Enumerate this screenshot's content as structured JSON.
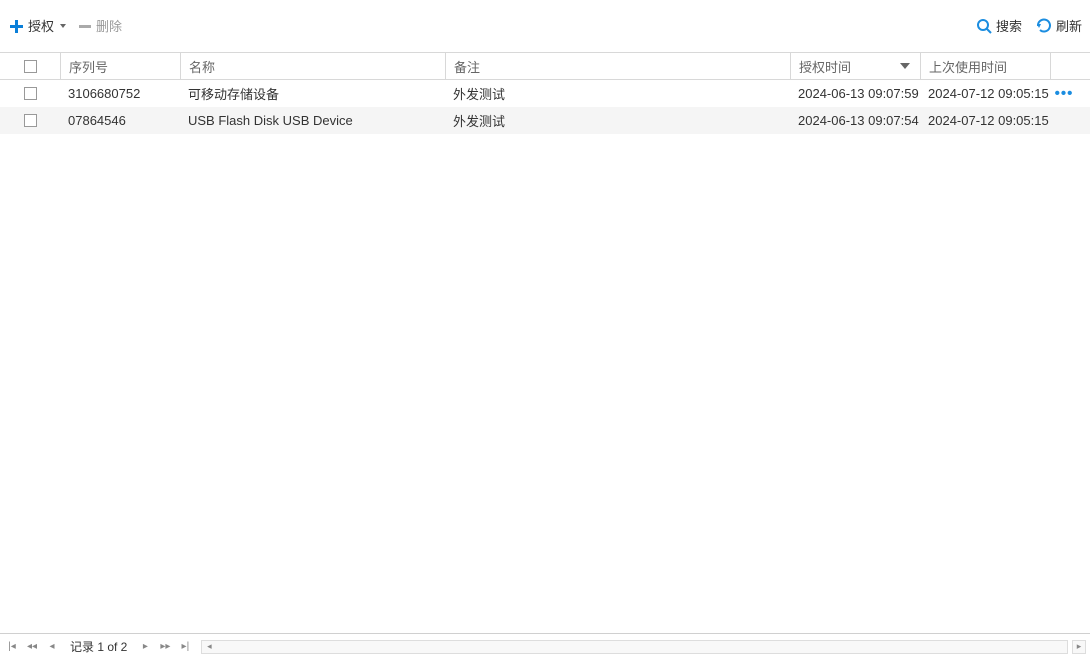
{
  "toolbar": {
    "authorize_label": "授权",
    "delete_label": "删除",
    "search_label": "搜索",
    "refresh_label": "刷新"
  },
  "columns": {
    "serial": "序列号",
    "name": "名称",
    "remark": "备注",
    "auth_time": "授权时间",
    "last_time": "上次使用时间"
  },
  "rows": [
    {
      "serial": "3106680752",
      "name": "可移动存储设备",
      "remark": "外发测试",
      "auth_time": "2024-06-13 09:07:59",
      "last_time": "2024-07-12 09:05:15"
    },
    {
      "serial": "07864546",
      "name": "USB Flash Disk USB Device",
      "remark": "外发测试",
      "auth_time": "2024-06-13 09:07:54",
      "last_time": "2024-07-12 09:05:15"
    }
  ],
  "pager": {
    "text": "记录 1 of 2"
  },
  "colors": {
    "accent": "#1b8de0"
  }
}
